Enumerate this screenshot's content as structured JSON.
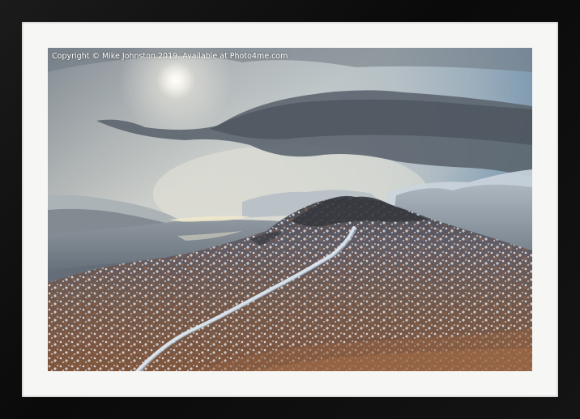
{
  "watermark": {
    "text": "Copyright  © Mike Johnston  2019. Available at Photo4me.com"
  },
  "frame": {
    "style": "black framed print with white mount",
    "frame_color": "#111111",
    "mount_color": "#f6f6f4"
  },
  "photo": {
    "subject": "snow-dusted hill with path under stormy sky",
    "colors": {
      "sky_light": "#d8d8d2",
      "sky_blue": "#7f9fb8",
      "cloud_dark": "#55606b",
      "snow": "#e8eef4",
      "heather": "#8a5a3a",
      "valley": "#8f98a0"
    }
  }
}
